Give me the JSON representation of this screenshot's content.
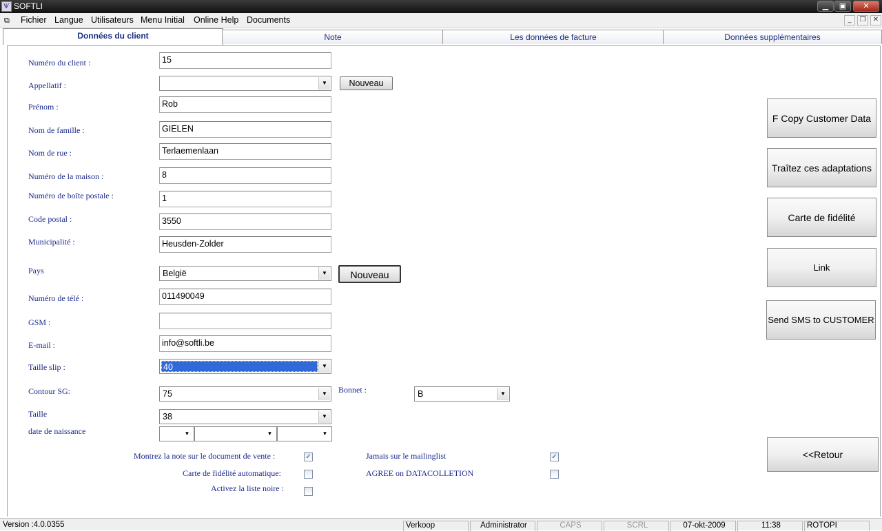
{
  "window": {
    "title": "SOFTLI",
    "app_icon": "softli-logo-icon",
    "controls": {
      "minimize": "minimize-icon",
      "restore": "restore-icon",
      "close": "close-icon"
    }
  },
  "menu": {
    "items": [
      "Fichier",
      "Langue",
      "Utilisateurs",
      "Menu Initial",
      "Online Help",
      "Documents"
    ]
  },
  "tabs": [
    {
      "label": "Données du client",
      "active": true
    },
    {
      "label": "Note",
      "active": false
    },
    {
      "label": "Les données de facture",
      "active": false
    },
    {
      "label": "Données supplémentaires",
      "active": false
    }
  ],
  "form": {
    "numero_client": {
      "label": "Numéro du client :",
      "value": "15"
    },
    "appellatif": {
      "label": "Appellatif :",
      "value": "",
      "new_button": "Nouveau"
    },
    "prenom": {
      "label": "Prénom :",
      "value": "Rob"
    },
    "nom_famille": {
      "label": "Nom de famille :",
      "value": "GIELEN"
    },
    "nom_rue": {
      "label": "Nom de rue :",
      "value": "Terlaemenlaan"
    },
    "numero_maison": {
      "label": "Numéro de la maison :",
      "value": "8"
    },
    "boite_postale": {
      "label": "Numéro de boîte postale :",
      "value": "1"
    },
    "code_postal": {
      "label": "Code postal :",
      "value": "3550"
    },
    "municipalite": {
      "label": "Municipalité :",
      "value": "Heusden-Zolder"
    },
    "pays": {
      "label": "Pays",
      "value": "België",
      "new_button": "Nouveau"
    },
    "telephone": {
      "label": "Numéro de télé :",
      "value": "011490049"
    },
    "gsm": {
      "label": "GSM :",
      "value": ""
    },
    "email": {
      "label": "E-mail :",
      "value": "info@softli.be"
    },
    "taille_slip": {
      "label": "Taille slip :",
      "value": "40"
    },
    "contour_sg": {
      "label": "Contour SG:",
      "value": "75"
    },
    "bonnet": {
      "label": "Bonnet :",
      "value": "B"
    },
    "taille": {
      "label": "Taille",
      "value": "38"
    },
    "date_naissance": {
      "label": "date de naissance",
      "day": "",
      "month": "",
      "year": ""
    }
  },
  "checkboxes": {
    "note_sur_document": {
      "label": "Montrez la note sur le document de vente :",
      "checked": true
    },
    "carte_fidelite_auto": {
      "label": "Carte de fidélité automatique:",
      "checked": false
    },
    "liste_noire": {
      "label": "Activez la liste noire :",
      "checked": false
    },
    "jamais_mailinglist": {
      "label": "Jamais sur le mailinglist",
      "checked": true
    },
    "agree_datacolletion": {
      "label": "AGREE on DATACOLLETION",
      "checked": false
    }
  },
  "actions": {
    "copy_customer": "F  Copy Customer Data",
    "traitez": "Traîtez ces adaptations",
    "carte_fidelite": "Carte de fidélité",
    "link": "Link",
    "send_sms": "Send SMS to CUSTOMER",
    "retour": "<<Retour"
  },
  "status": {
    "version": "Version :4.0.0355",
    "mode": "Verkoop",
    "user": "Administrator",
    "caps": "CAPS",
    "scrl": "SCRL",
    "date": "07-okt-2009",
    "time": "11:38",
    "company": "ROTOPI"
  },
  "colors": {
    "label_blue": "#1a2a8c",
    "selection_blue": "#3069d8",
    "checkmark": "#27429c"
  }
}
